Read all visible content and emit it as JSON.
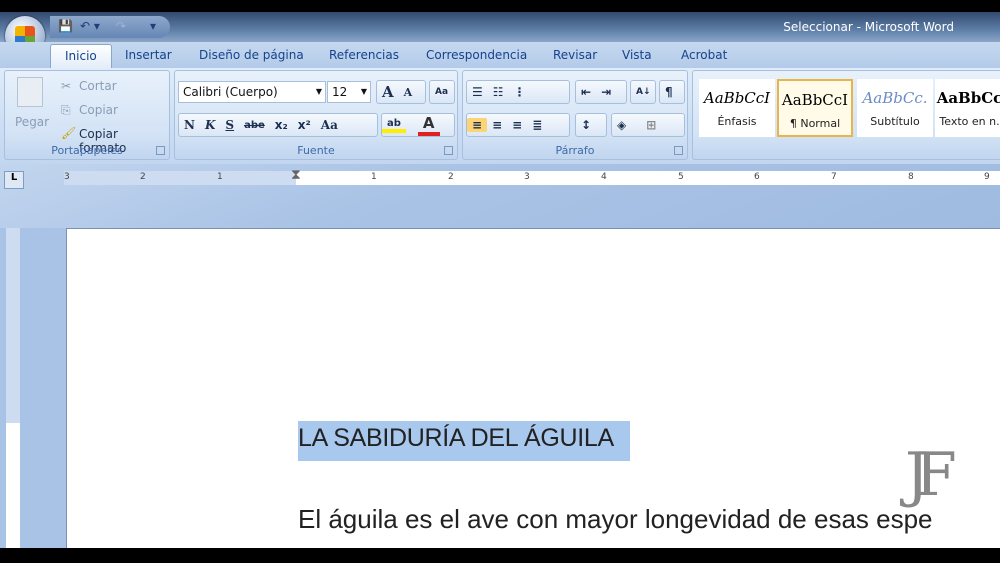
{
  "window": {
    "title": "Seleccionar - Microsoft Word"
  },
  "qat": {
    "save": "💾",
    "undo": "↶ ▾",
    "redo": "↷",
    "customize": "▾"
  },
  "tabs": [
    "Inicio",
    "Insertar",
    "Diseño de página",
    "Referencias",
    "Correspondencia",
    "Revisar",
    "Vista",
    "Acrobat"
  ],
  "clipboard": {
    "paste": "Pegar",
    "cut": "Cortar",
    "copy": "Copiar",
    "format_painter": "Copiar formato",
    "label": "Portapapeles"
  },
  "font": {
    "name": "Calibri (Cuerpo)",
    "size": "12",
    "grow": "A",
    "shrink": "A",
    "clear": "Aa",
    "bold": "N",
    "italic": "K",
    "underline": "S",
    "strike": "abe",
    "sub": "x₂",
    "sup": "x²",
    "case": "Aa",
    "highlight": "ab",
    "color": "A",
    "label": "Fuente"
  },
  "paragraph": {
    "label": "Párrafo",
    "bullets": "☰",
    "numbering": "☷",
    "multilevel": "⋮",
    "dec_indent": "⇤",
    "inc_indent": "⇥",
    "sort": "A↓",
    "show": "¶",
    "left": "≡",
    "center": "≡",
    "right": "≡",
    "justify": "≣",
    "spacing": "↕",
    "shading": "◈",
    "borders": "⊞"
  },
  "styles": [
    {
      "sample": "AaBbCcI",
      "name": "Énfasis"
    },
    {
      "sample": "AaBbCcI",
      "name": "¶ Normal"
    },
    {
      "sample": "AaBbCc.",
      "name": "Subtítulo"
    },
    {
      "sample": "AaBbCcI",
      "name": "Texto en n..."
    }
  ],
  "ruler": {
    "tab_selector": "L",
    "numbers_left": [
      "3",
      "2",
      "1"
    ],
    "numbers_right": [
      "1",
      "2",
      "3",
      "4",
      "5",
      "6",
      "7",
      "8",
      "9"
    ]
  },
  "document": {
    "heading": "LA SABIDURÍA DEL ÁGUILA",
    "paragraph": "El águila es el ave con mayor longevidad de esas espe"
  },
  "watermark": "JF"
}
